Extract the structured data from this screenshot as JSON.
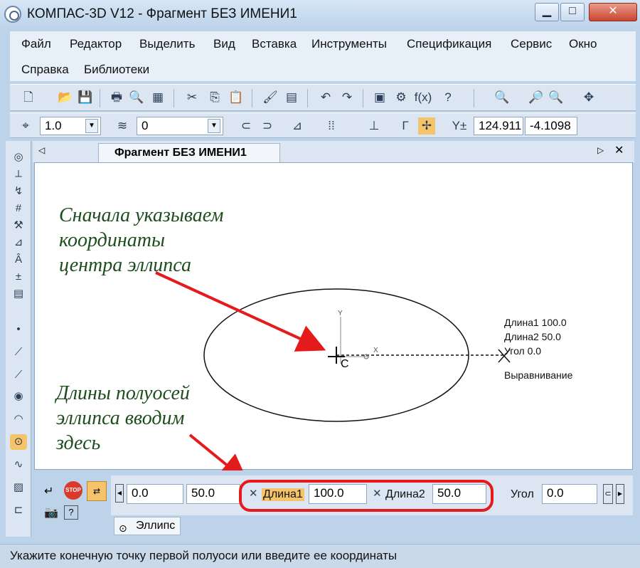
{
  "window": {
    "title": "КОМПАС-3D V12 - Фрагмент БЕЗ ИМЕНИ1"
  },
  "menu": {
    "row1": [
      "Файл",
      "Редактор",
      "Выделить",
      "Вид",
      "Вставка",
      "Инструменты",
      "Спецификация",
      "Сервис",
      "Окно"
    ],
    "row2": [
      "Справка",
      "Библиотеки"
    ]
  },
  "toolbar2": {
    "scale_value": "1.0",
    "layer_value": "0",
    "coord_x": "124.911",
    "coord_y": "-4.1098"
  },
  "document": {
    "tab_label": "Фрагмент БЕЗ ИМЕНИ1"
  },
  "canvas": {
    "annotation_top": [
      "Сначала указываем",
      "координаты",
      "центра эллипса"
    ],
    "annotation_bottom": [
      "Длины полуосей",
      "эллипса вводим",
      "здесь"
    ],
    "cursor_readout": [
      "Длина1 100.0",
      "Длина2 50.0",
      "Угол   0.0"
    ],
    "alignment_label": "Выравнивание",
    "axis_y_label": "Y",
    "axis_x_label": "X",
    "center_label": "C"
  },
  "property_panel": {
    "center_x": "0.0",
    "center_y": "50.0",
    "length1_label": "Длина1",
    "length1_value": "100.0",
    "length2_label": "Длина2",
    "length2_value": "50.0",
    "angle_label": "Угол",
    "angle_value": "0.0",
    "stop_label": "STOP",
    "tab_label": "Эллипс"
  },
  "status": {
    "text": "Укажите конечную точку первой полуоси или введите ее координаты"
  },
  "colors": {
    "annotation_arrow": "#e51b1b",
    "annotation_text": "#1c4d1c"
  }
}
